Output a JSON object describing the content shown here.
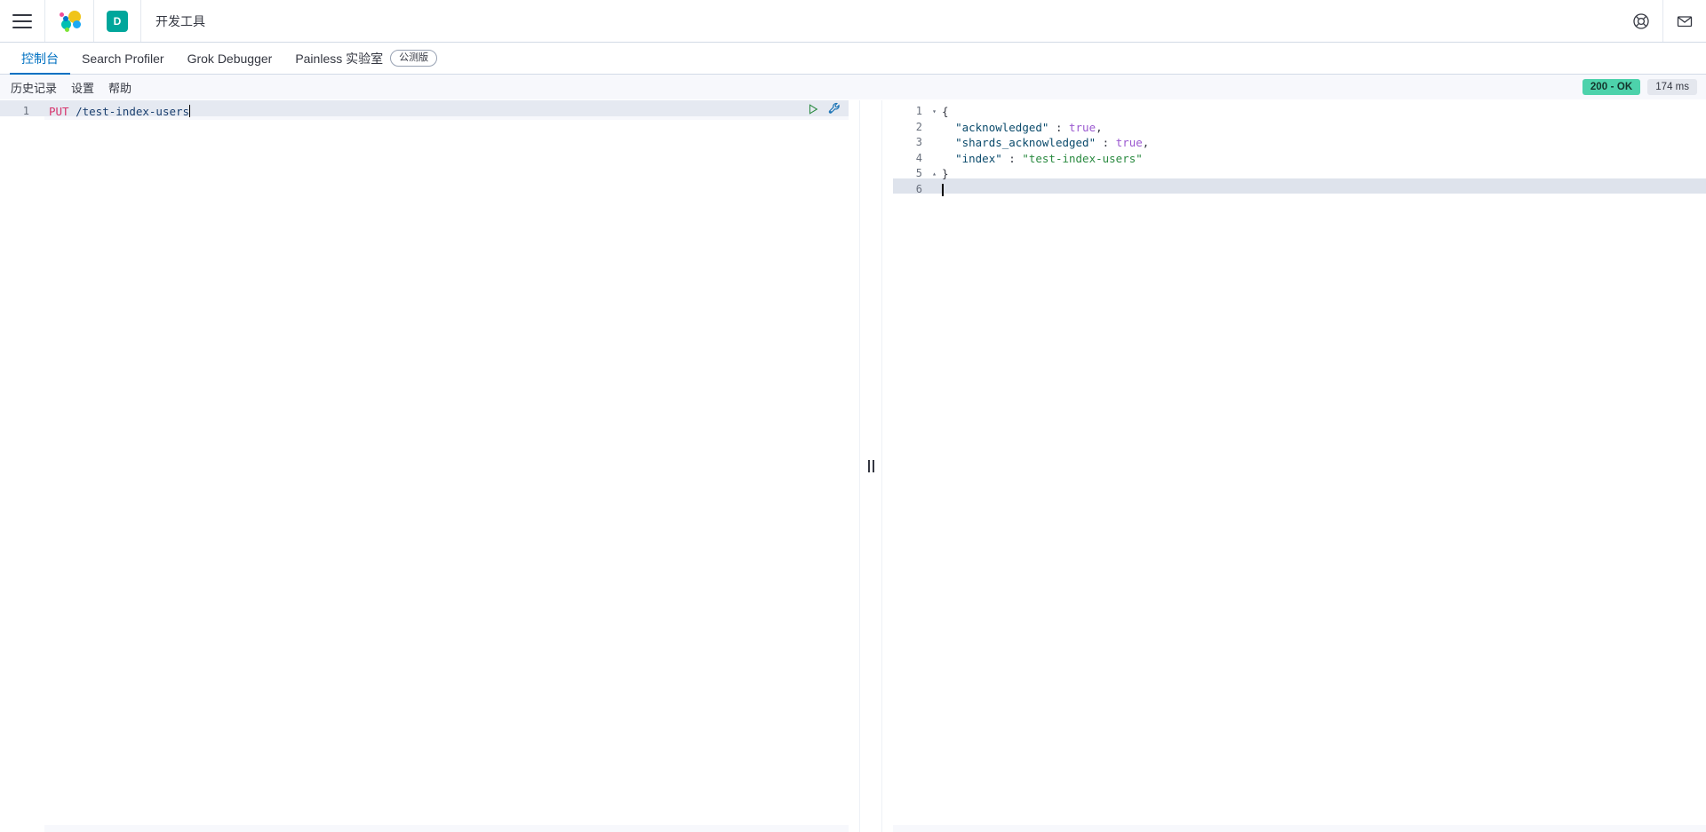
{
  "chrome": {
    "menu_icon": "hamburger-menu-icon",
    "logo_icon": "elastic-logo-icon",
    "space_initial": "D",
    "app_title": "开发工具",
    "help_icon": "lifebuoy-help-icon",
    "mail_icon": "envelope-mail-icon"
  },
  "tabs": [
    {
      "label": "控制台",
      "active": true,
      "badge": ""
    },
    {
      "label": "Search Profiler",
      "active": false,
      "badge": ""
    },
    {
      "label": "Grok Debugger",
      "active": false,
      "badge": ""
    },
    {
      "label": "Painless 实验室",
      "active": false,
      "badge": "公测版"
    }
  ],
  "console_toolbar": {
    "items": [
      {
        "label": "历史记录"
      },
      {
        "label": "设置"
      },
      {
        "label": "帮助"
      }
    ]
  },
  "response_status": {
    "status_label": "200 - OK",
    "time_label": "174 ms",
    "status_color": "#4dd2ab",
    "time_color": "#e4e7ee"
  },
  "request_editor": {
    "actions": {
      "play_icon": "play-send-request-icon",
      "wrench_icon": "wrench-settings-icon"
    },
    "lines": [
      {
        "number": "1",
        "fold": "",
        "method": "PUT",
        "space": " ",
        "path": "/test-index-users"
      }
    ]
  },
  "response_editor": {
    "lines": [
      {
        "number": "1",
        "fold": "▾",
        "text": "{"
      },
      {
        "number": "2",
        "fold": "",
        "text": ""
      },
      {
        "number": "3",
        "fold": "",
        "text": ""
      },
      {
        "number": "4",
        "fold": "",
        "text": ""
      },
      {
        "number": "5",
        "fold": "▴",
        "text": "}"
      },
      {
        "number": "6",
        "fold": "",
        "text": ""
      }
    ],
    "json": {
      "open_brace": "{",
      "close_brace": "}",
      "indent": "  ",
      "rows": [
        {
          "key": "\"acknowledged\"",
          "sep": " : ",
          "value": "true",
          "value_type": "bool",
          "comma": ","
        },
        {
          "key": "\"shards_acknowledged\"",
          "sep": " : ",
          "value": "true",
          "value_type": "bool",
          "comma": ","
        },
        {
          "key": "\"index\"",
          "sep": " : ",
          "value": "\"test-index-users\"",
          "value_type": "string",
          "comma": ""
        }
      ]
    }
  },
  "resizer": {
    "grip_icon": "vertical-resize-grip-icon"
  }
}
